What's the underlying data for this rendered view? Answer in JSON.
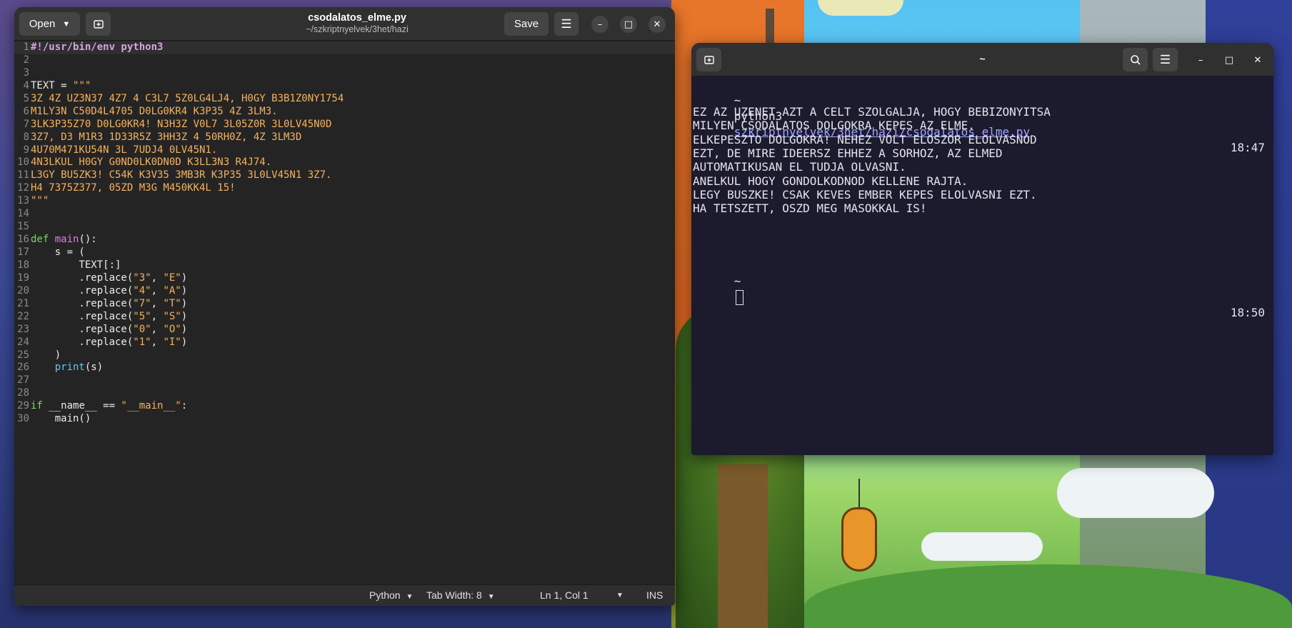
{
  "editor": {
    "open_label": "Open",
    "save_label": "Save",
    "title": "csodalatos_elme.py",
    "path": "~/szkriptnyelvek/3het/hazi",
    "lines": [
      {
        "n": "1",
        "tokens": [
          {
            "c": "t-she",
            "t": "#!/usr/bin/env python3"
          }
        ]
      },
      {
        "n": "2",
        "tokens": []
      },
      {
        "n": "3",
        "tokens": []
      },
      {
        "n": "4",
        "tokens": [
          {
            "c": "t-pl",
            "t": "TEXT = "
          },
          {
            "c": "t-str",
            "t": "\"\"\""
          }
        ]
      },
      {
        "n": "5",
        "tokens": [
          {
            "c": "t-str",
            "t": "3Z 4Z UZ3N37 4Z7 4 C3L7 5Z0LG4LJ4, H0GY B3B1Z0NY1754"
          }
        ]
      },
      {
        "n": "6",
        "tokens": [
          {
            "c": "t-str",
            "t": "M1LY3N C50D4L4705 D0LG0KR4 K3P35 4Z 3LM3."
          }
        ]
      },
      {
        "n": "7",
        "tokens": [
          {
            "c": "t-str",
            "t": "3LK3P35Z70 D0LG0KR4! N3H3Z V0L7 3L05Z0R 3L0LV45N0D"
          }
        ]
      },
      {
        "n": "8",
        "tokens": [
          {
            "c": "t-str",
            "t": "3Z7, D3 M1R3 1D33R5Z 3HH3Z 4 50RH0Z, 4Z 3LM3D"
          }
        ]
      },
      {
        "n": "9",
        "tokens": [
          {
            "c": "t-str",
            "t": "4U70M471KU54N 3L 7UDJ4 0LV45N1."
          }
        ]
      },
      {
        "n": "10",
        "tokens": [
          {
            "c": "t-str",
            "t": "4N3LKUL H0GY G0ND0LK0DN0D K3LL3N3 R4J74."
          }
        ]
      },
      {
        "n": "11",
        "tokens": [
          {
            "c": "t-str",
            "t": "L3GY BU5ZK3! C54K K3V35 3MB3R K3P35 3L0LV45N1 3Z7."
          }
        ]
      },
      {
        "n": "12",
        "tokens": [
          {
            "c": "t-str",
            "t": "H4 7375Z377, 05ZD M3G M450KK4L 15!"
          }
        ]
      },
      {
        "n": "13",
        "tokens": [
          {
            "c": "t-str",
            "t": "\"\"\""
          }
        ]
      },
      {
        "n": "14",
        "tokens": []
      },
      {
        "n": "15",
        "tokens": []
      },
      {
        "n": "16",
        "tokens": [
          {
            "c": "t-kw",
            "t": "def "
          },
          {
            "c": "t-fn",
            "t": "main"
          },
          {
            "c": "t-pl",
            "t": "():"
          }
        ]
      },
      {
        "n": "17",
        "tokens": [
          {
            "c": "t-pl",
            "t": "    s = ("
          }
        ]
      },
      {
        "n": "18",
        "tokens": [
          {
            "c": "t-pl",
            "t": "        TEXT[:]"
          }
        ]
      },
      {
        "n": "19",
        "tokens": [
          {
            "c": "t-pl",
            "t": "        .replace("
          },
          {
            "c": "t-str",
            "t": "\"3\""
          },
          {
            "c": "t-pl",
            "t": ", "
          },
          {
            "c": "t-str",
            "t": "\"E\""
          },
          {
            "c": "t-pl",
            "t": ")"
          }
        ]
      },
      {
        "n": "20",
        "tokens": [
          {
            "c": "t-pl",
            "t": "        .replace("
          },
          {
            "c": "t-str",
            "t": "\"4\""
          },
          {
            "c": "t-pl",
            "t": ", "
          },
          {
            "c": "t-str",
            "t": "\"A\""
          },
          {
            "c": "t-pl",
            "t": ")"
          }
        ]
      },
      {
        "n": "21",
        "tokens": [
          {
            "c": "t-pl",
            "t": "        .replace("
          },
          {
            "c": "t-str",
            "t": "\"7\""
          },
          {
            "c": "t-pl",
            "t": ", "
          },
          {
            "c": "t-str",
            "t": "\"T\""
          },
          {
            "c": "t-pl",
            "t": ")"
          }
        ]
      },
      {
        "n": "22",
        "tokens": [
          {
            "c": "t-pl",
            "t": "        .replace("
          },
          {
            "c": "t-str",
            "t": "\"5\""
          },
          {
            "c": "t-pl",
            "t": ", "
          },
          {
            "c": "t-str",
            "t": "\"S\""
          },
          {
            "c": "t-pl",
            "t": ")"
          }
        ]
      },
      {
        "n": "23",
        "tokens": [
          {
            "c": "t-pl",
            "t": "        .replace("
          },
          {
            "c": "t-str",
            "t": "\"0\""
          },
          {
            "c": "t-pl",
            "t": ", "
          },
          {
            "c": "t-str",
            "t": "\"O\""
          },
          {
            "c": "t-pl",
            "t": ")"
          }
        ]
      },
      {
        "n": "24",
        "tokens": [
          {
            "c": "t-pl",
            "t": "        .replace("
          },
          {
            "c": "t-str",
            "t": "\"1\""
          },
          {
            "c": "t-pl",
            "t": ", "
          },
          {
            "c": "t-str",
            "t": "\"I\""
          },
          {
            "c": "t-pl",
            "t": ")"
          }
        ]
      },
      {
        "n": "25",
        "tokens": [
          {
            "c": "t-pl",
            "t": "    )"
          }
        ]
      },
      {
        "n": "26",
        "tokens": [
          {
            "c": "t-pl",
            "t": "    "
          },
          {
            "c": "t-bi",
            "t": "print"
          },
          {
            "c": "t-pl",
            "t": "(s)"
          }
        ]
      },
      {
        "n": "27",
        "tokens": []
      },
      {
        "n": "28",
        "tokens": []
      },
      {
        "n": "29",
        "tokens": [
          {
            "c": "t-kw",
            "t": "if "
          },
          {
            "c": "t-pl",
            "t": "__name__ == "
          },
          {
            "c": "t-str",
            "t": "\"__main__\""
          },
          {
            "c": "t-pl",
            "t": ":"
          }
        ]
      },
      {
        "n": "30",
        "tokens": [
          {
            "c": "t-pl",
            "t": "    main()"
          }
        ]
      }
    ],
    "status": {
      "language": "Python",
      "tab_width": "Tab Width: 8",
      "position": "Ln 1, Col 1",
      "mode": "INS"
    }
  },
  "terminal": {
    "title": "~",
    "prompt": "~",
    "command": "python3",
    "command_path": "szkriptnyelvek/3het/hazi/csodalatos_elme.py",
    "time_1": "18:47",
    "output": [
      "EZ AZ UZENET AZT A CELT SZOLGALJA, HOGY BEBIZONYITSA",
      "MILYEN CSODALATOS DOLGOKRA KEPES AZ ELME.",
      "ELKEPESZTO DOLGOKRA! NEHEZ VOLT ELOSZOR ELOLVASNOD",
      "EZT, DE MIRE IDEERSZ EHHEZ A SORHOZ, AZ ELMED",
      "AUTOMATIKUSAN EL TUDJA OLVASNI.",
      "ANELKUL HOGY GONDOLKODNOD KELLENE RAJTA.",
      "LEGY BUSZKE! CSAK KEVES EMBER KEPES ELOLVASNI EZT.",
      "HA TETSZETT, OSZD MEG MASOKKAL IS!"
    ],
    "time_2": "18:50"
  }
}
